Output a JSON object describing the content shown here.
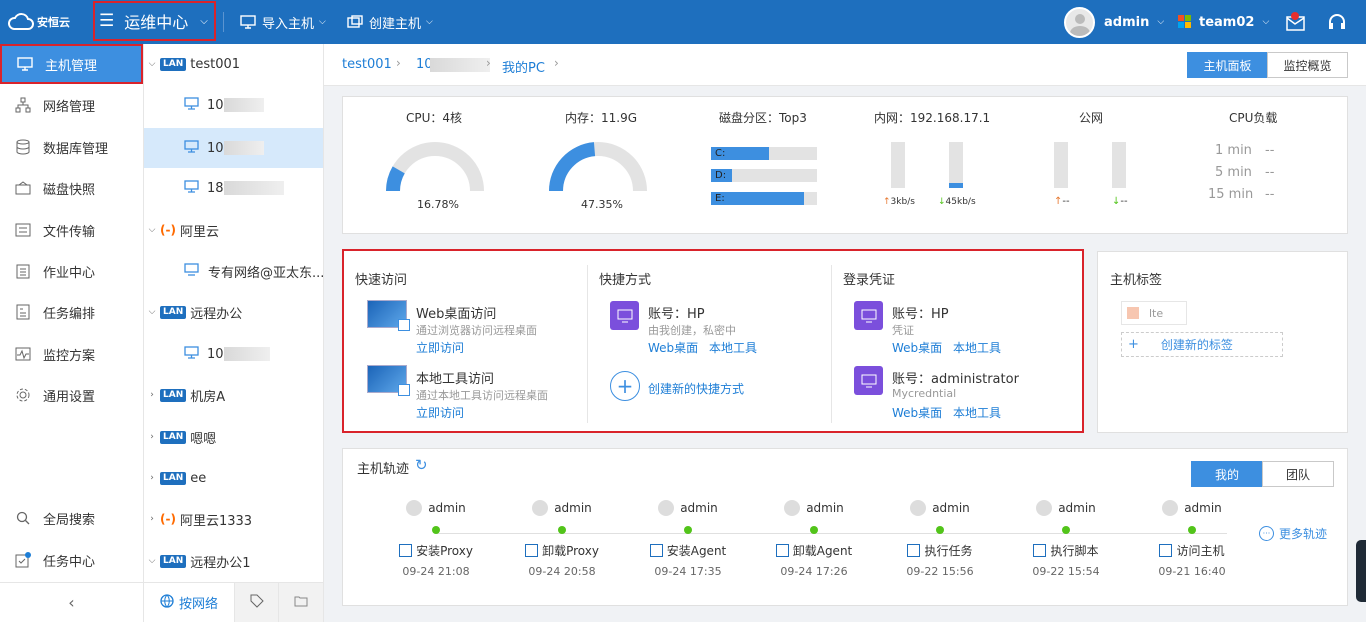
{
  "topbar": {
    "brand": "安恒云",
    "menu_title": "运维中心",
    "import_host": "导入主机",
    "create_host": "创建主机",
    "user": "admin",
    "team": "team02"
  },
  "sidebar": {
    "items": [
      {
        "label": "主机管理",
        "icon": "monitor-icon"
      },
      {
        "label": "网络管理",
        "icon": "network-icon"
      },
      {
        "label": "数据库管理",
        "icon": "database-icon"
      },
      {
        "label": "磁盘快照",
        "icon": "disk-icon"
      },
      {
        "label": "文件传输",
        "icon": "file-transfer-icon"
      },
      {
        "label": "作业中心",
        "icon": "job-icon"
      },
      {
        "label": "任务编排",
        "icon": "task-flow-icon"
      },
      {
        "label": "监控方案",
        "icon": "monitor-chart-icon"
      },
      {
        "label": "通用设置",
        "icon": "gear-icon"
      }
    ],
    "bottom": [
      {
        "label": "全局搜索",
        "icon": "search-icon"
      },
      {
        "label": "任务中心",
        "icon": "task-center-icon"
      }
    ],
    "collapse": "‹"
  },
  "tree": {
    "nodes": [
      {
        "label": "test001",
        "type": "lan"
      },
      {
        "label": "10",
        "type": "host"
      },
      {
        "label": "10",
        "type": "host"
      },
      {
        "label": "18",
        "type": "host"
      },
      {
        "label": "阿里云",
        "type": "aliyun"
      },
      {
        "label": "专有网络@亚太东...",
        "type": "vpc"
      },
      {
        "label": "远程办公",
        "type": "lan"
      },
      {
        "label": "10",
        "type": "host"
      },
      {
        "label": "机房A",
        "type": "lan"
      },
      {
        "label": "嗯嗯",
        "type": "lan"
      },
      {
        "label": "ee",
        "type": "lan"
      },
      {
        "label": "阿里云1333",
        "type": "aliyun"
      },
      {
        "label": "远程办公1",
        "type": "lan"
      }
    ],
    "lan_badge": "LAN",
    "bottom_tab": "按网络"
  },
  "breadcrumb": {
    "items": [
      "test001",
      "10",
      "我的PC"
    ],
    "tabs": [
      "主机面板",
      "监控概览"
    ]
  },
  "stats": {
    "cpu_label": "CPU：4核",
    "cpu_value": "16.78%",
    "cpu_percent": 16.78,
    "mem_label": "内存：11.9G",
    "mem_value": "47.35%",
    "mem_percent": 47.35,
    "disk_label": "磁盘分区：Top3",
    "disks": [
      {
        "name": "C:",
        "percent": 55
      },
      {
        "name": "D:",
        "percent": 20
      },
      {
        "name": "E:",
        "percent": 88
      }
    ],
    "lan_label": "内网：192.168.17.1",
    "lan_up": "3kb/s",
    "lan_down": "45kb/s",
    "lan_up_level": 0,
    "lan_down_level": 10,
    "wan_label": "公网",
    "wan_up": "--",
    "wan_down": "--",
    "load_label": "CPU负载",
    "loads": [
      {
        "label": "1 min",
        "value": "--"
      },
      {
        "label": "5 min",
        "value": "--"
      },
      {
        "label": "15 min",
        "value": "--"
      }
    ]
  },
  "quick": {
    "title": "快速访问",
    "items": [
      {
        "title": "Web桌面访问",
        "desc": "通过浏览器访问远程桌面",
        "action": "立即访问"
      },
      {
        "title": "本地工具访问",
        "desc": "通过本地工具访问远程桌面",
        "action": "立即访问"
      }
    ]
  },
  "shortcut": {
    "title": "快捷方式",
    "account": "账号：HP",
    "desc": "由我创建，私密中",
    "links": [
      "Web桌面",
      "本地工具"
    ],
    "create": "创建新的快捷方式"
  },
  "credential": {
    "title": "登录凭证",
    "items": [
      {
        "account": "账号：HP",
        "desc": "凭证",
        "links": [
          "Web桌面",
          "本地工具"
        ]
      },
      {
        "account": "账号：administrator",
        "desc": "Mycredntial",
        "links": [
          "Web桌面",
          "本地工具"
        ]
      }
    ]
  },
  "tags": {
    "title": "主机标签",
    "tag": "lte",
    "create": "创建新的标签"
  },
  "timeline": {
    "title": "主机轨迹",
    "tabs": [
      "我的",
      "团队"
    ],
    "more": "更多轨迹",
    "events": [
      {
        "user": "admin",
        "action": "安装Proxy",
        "time": "09-24 21:08"
      },
      {
        "user": "admin",
        "action": "卸载Proxy",
        "time": "09-24 20:58"
      },
      {
        "user": "admin",
        "action": "安装Agent",
        "time": "09-24 17:35"
      },
      {
        "user": "admin",
        "action": "卸载Agent",
        "time": "09-24 17:26"
      },
      {
        "user": "admin",
        "action": "执行任务",
        "time": "09-22 15:56"
      },
      {
        "user": "admin",
        "action": "执行脚本",
        "time": "09-22 15:54"
      },
      {
        "user": "admin",
        "action": "访问主机",
        "time": "09-21 16:40"
      }
    ]
  },
  "colors": {
    "primary": "#1e6fbe",
    "accent": "#3d8fe0",
    "highlight_border": "#d9232b",
    "green": "#52c41a"
  }
}
